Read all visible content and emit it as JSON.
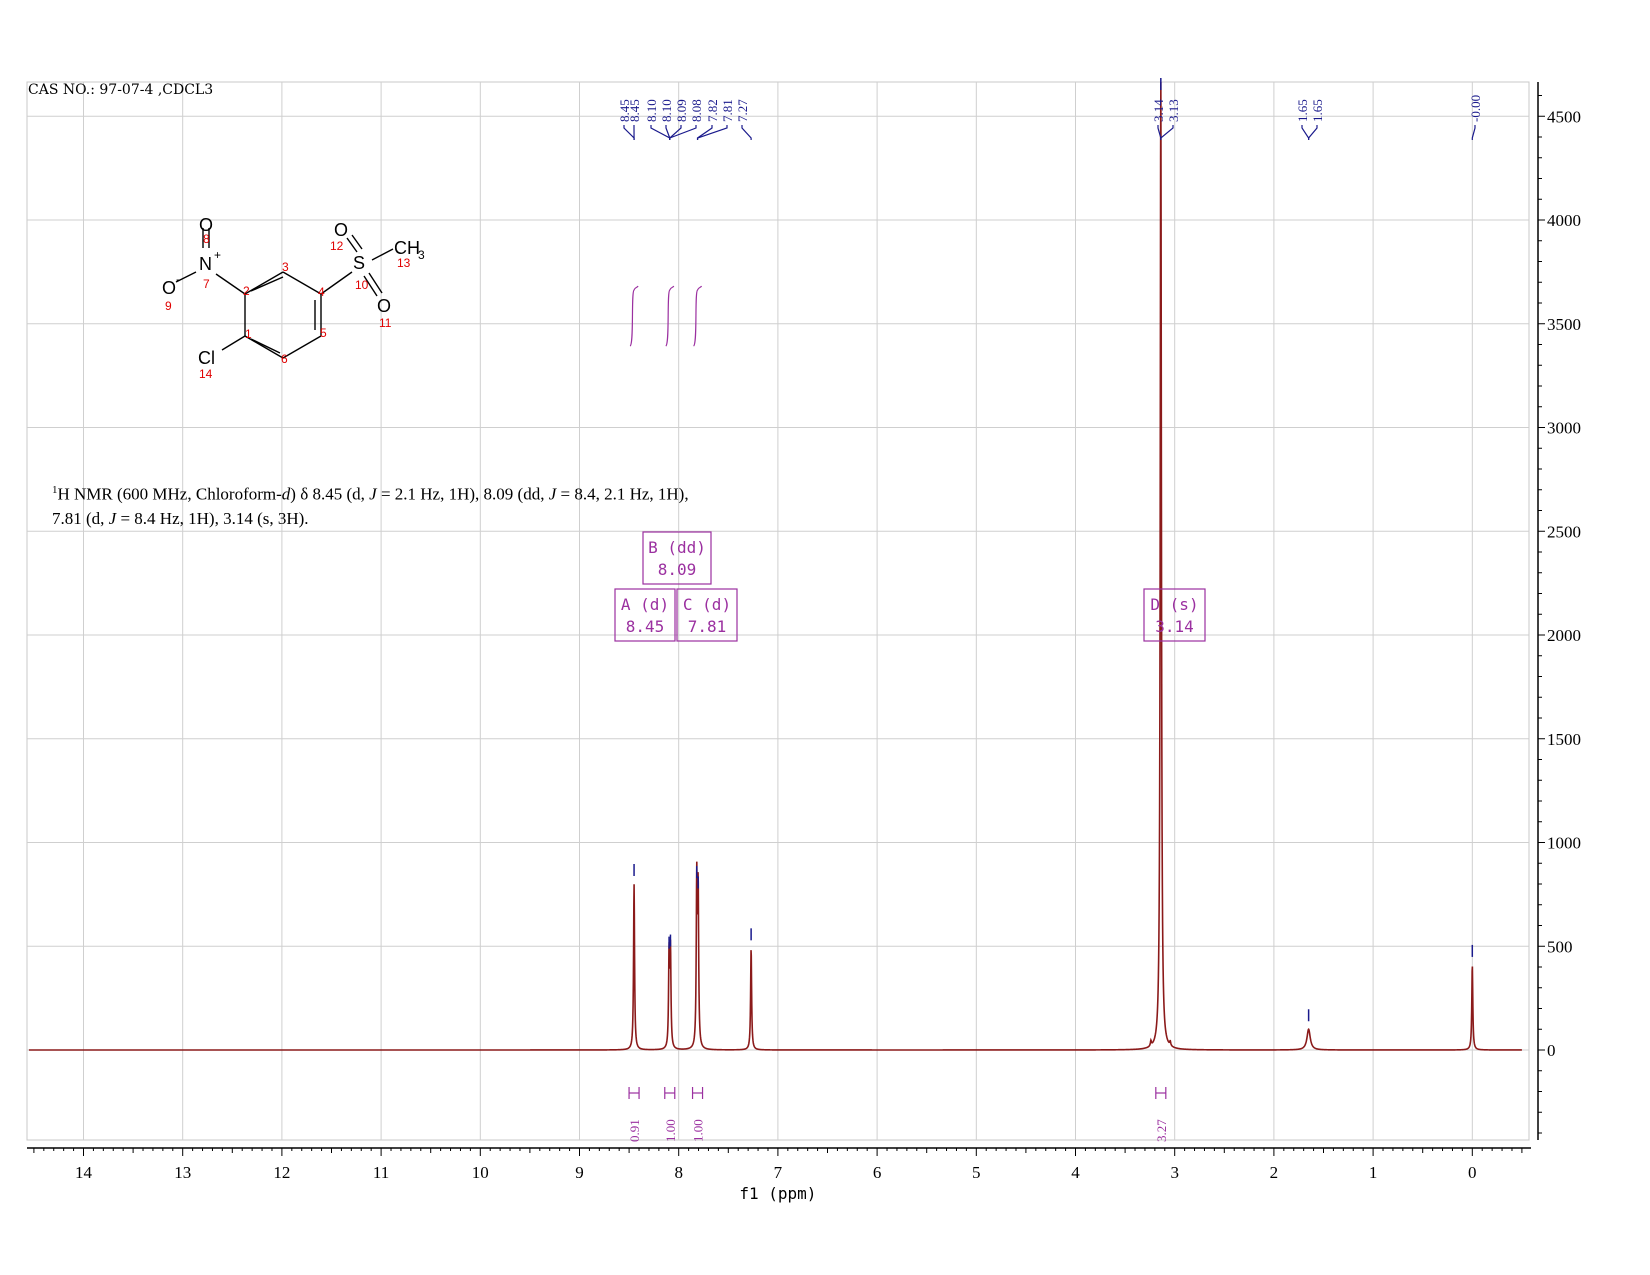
{
  "header": {
    "cas_label": "CAS NO.: 97-07-4 ,CDCL3"
  },
  "description": {
    "h_sup": "1",
    "line1": "H NMR (600 MHz, Chloroform-",
    "solvent_d": "d",
    "line1b": ") δ 8.45 (d, ",
    "j": "J",
    "line1c": " = 2.1 Hz, 1H), 8.09 (dd, ",
    "line1d": " = 8.4, 2.1 Hz, 1H),",
    "line2a": "7.81 (d, ",
    "line2b": " = 8.4 Hz, 1H), 3.14 (s, 3H)."
  },
  "structure": {
    "atoms": [
      {
        "label": "O",
        "num": "8"
      },
      {
        "label": "N",
        "charge": "+",
        "num": "7"
      },
      {
        "label": "O",
        "charge": "-",
        "num": "9"
      },
      {
        "label": "Cl",
        "num": "14"
      },
      {
        "label": "S",
        "num": "10"
      },
      {
        "label": "O",
        "num": "12"
      },
      {
        "label": "O",
        "num": "11"
      },
      {
        "label": "CH",
        "sub": "3",
        "num": "13"
      }
    ],
    "ring_numbers": [
      "1",
      "2",
      "3",
      "4",
      "5",
      "6"
    ]
  },
  "chart_data": {
    "type": "line",
    "xlabel": "f1 (ppm)",
    "xlim": [
      14.55,
      -0.5
    ],
    "ylim": [
      -430,
      4680
    ],
    "x_ticks": [
      14,
      13,
      12,
      11,
      10,
      9,
      8,
      7,
      6,
      5,
      4,
      3,
      2,
      1,
      0
    ],
    "y_ticks": [
      0,
      500,
      1000,
      1500,
      2000,
      2500,
      3000,
      3500,
      4000,
      4500
    ],
    "grid": true,
    "line_color": "#8b1a1a",
    "peak_label_color": "#1a1a8c",
    "annotation_color": "#9b30a0",
    "peaks": [
      {
        "ppm": 8.45,
        "height": 800,
        "width": 0.006
      },
      {
        "ppm": 8.097,
        "height": 450,
        "width": 0.006
      },
      {
        "ppm": 8.083,
        "height": 460,
        "width": 0.006
      },
      {
        "ppm": 7.818,
        "height": 790,
        "width": 0.006
      },
      {
        "ppm": 7.804,
        "height": 740,
        "width": 0.006
      },
      {
        "ppm": 7.27,
        "height": 490,
        "width": 0.006
      },
      {
        "ppm": 3.14,
        "height": 4680,
        "width": 0.007
      },
      {
        "ppm": 3.045,
        "height": 20,
        "width": 0.006
      },
      {
        "ppm": 3.24,
        "height": 25,
        "width": 0.006
      },
      {
        "ppm": 1.65,
        "height": 100,
        "width": 0.02
      },
      {
        "ppm": 0.0,
        "height": 410,
        "width": 0.006
      }
    ],
    "peak_label_groups": [
      {
        "labels": [
          "8.45",
          "8.45"
        ],
        "target": 8.45
      },
      {
        "labels": [
          "8.10",
          "8.10",
          "8.09",
          "8.08"
        ],
        "target": 8.09
      },
      {
        "labels": [
          "7.82",
          "7.81"
        ],
        "target": 7.81
      },
      {
        "labels": [
          "7.27"
        ],
        "target": 7.27
      },
      {
        "labels": [
          "3.14",
          "3.13"
        ],
        "target": 3.14
      },
      {
        "labels": [
          "1.65",
          "1.65"
        ],
        "target": 1.65
      },
      {
        "labels": [
          "-0.00"
        ],
        "target": 0.0
      }
    ],
    "integrals": [
      {
        "ppm": 8.45,
        "value": "0.91"
      },
      {
        "ppm": 8.09,
        "value": "1.00"
      },
      {
        "ppm": 7.81,
        "value": "1.00"
      },
      {
        "ppm": 3.14,
        "value": "3.27"
      }
    ],
    "multiplets": [
      {
        "label": "A (d)",
        "shift": "8.45"
      },
      {
        "label": "B (dd)",
        "shift": "8.09"
      },
      {
        "label": "C (d)",
        "shift": "7.81"
      },
      {
        "label": "D (s)",
        "shift": "3.14"
      }
    ]
  }
}
